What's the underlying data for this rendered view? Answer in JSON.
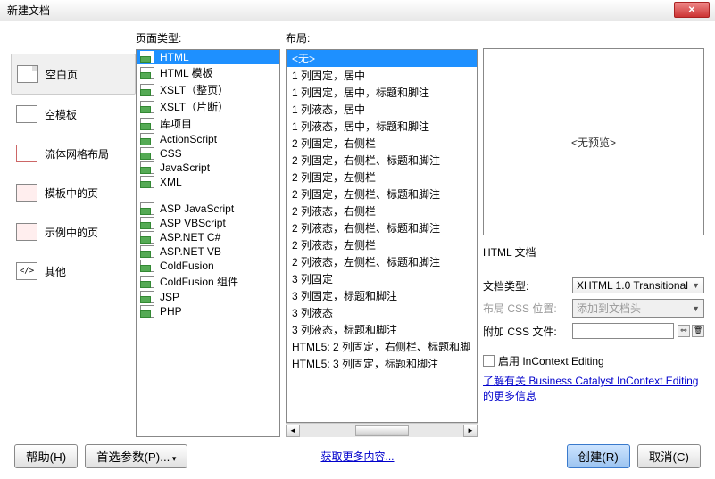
{
  "title": "新建文档",
  "sidebar": {
    "items": [
      {
        "label": "空白页"
      },
      {
        "label": "空模板"
      },
      {
        "label": "流体网格布局"
      },
      {
        "label": "模板中的页"
      },
      {
        "label": "示例中的页"
      },
      {
        "label": "其他"
      }
    ]
  },
  "pageType": {
    "header": "页面类型:",
    "group1": [
      {
        "label": "HTML"
      },
      {
        "label": "HTML 模板"
      },
      {
        "label": "XSLT（整页）"
      },
      {
        "label": "XSLT（片断）"
      },
      {
        "label": "库项目"
      },
      {
        "label": "ActionScript"
      },
      {
        "label": "CSS"
      },
      {
        "label": "JavaScript"
      },
      {
        "label": "XML"
      }
    ],
    "group2": [
      {
        "label": "ASP JavaScript"
      },
      {
        "label": "ASP VBScript"
      },
      {
        "label": "ASP.NET C#"
      },
      {
        "label": "ASP.NET VB"
      },
      {
        "label": "ColdFusion"
      },
      {
        "label": "ColdFusion 组件"
      },
      {
        "label": "JSP"
      },
      {
        "label": "PHP"
      }
    ]
  },
  "layout": {
    "header": "布局:",
    "items": [
      "<无>",
      "1 列固定，居中",
      "1 列固定，居中，标题和脚注",
      "1 列液态，居中",
      "1 列液态，居中，标题和脚注",
      "2 列固定，右侧栏",
      "2 列固定，右侧栏、标题和脚注",
      "2 列固定，左侧栏",
      "2 列固定，左侧栏、标题和脚注",
      "2 列液态，右侧栏",
      "2 列液态，右侧栏、标题和脚注",
      "2 列液态，左侧栏",
      "2 列液态，左侧栏、标题和脚注",
      "3 列固定",
      "3 列固定，标题和脚注",
      "3 列液态",
      "3 列液态，标题和脚注",
      "HTML5: 2 列固定，右侧栏、标题和脚",
      "HTML5: 3 列固定，标题和脚注"
    ]
  },
  "right": {
    "preview_empty": "<无预览>",
    "preview_desc": "HTML 文档",
    "doctype_label": "文档类型:",
    "doctype_value": "XHTML 1.0 Transitional",
    "csspos_label": "布局 CSS 位置:",
    "csspos_value": "添加到文档头",
    "attach_label": "附加 CSS 文件:",
    "incontext_label": "启用 InContext Editing",
    "incontext_link": "了解有关 Business Catalyst InContext Editing 的更多信息"
  },
  "footer": {
    "help": "帮助(H)",
    "prefs": "首选参数(P)...",
    "more": "获取更多内容...",
    "create": "创建(R)",
    "cancel": "取消(C)"
  }
}
